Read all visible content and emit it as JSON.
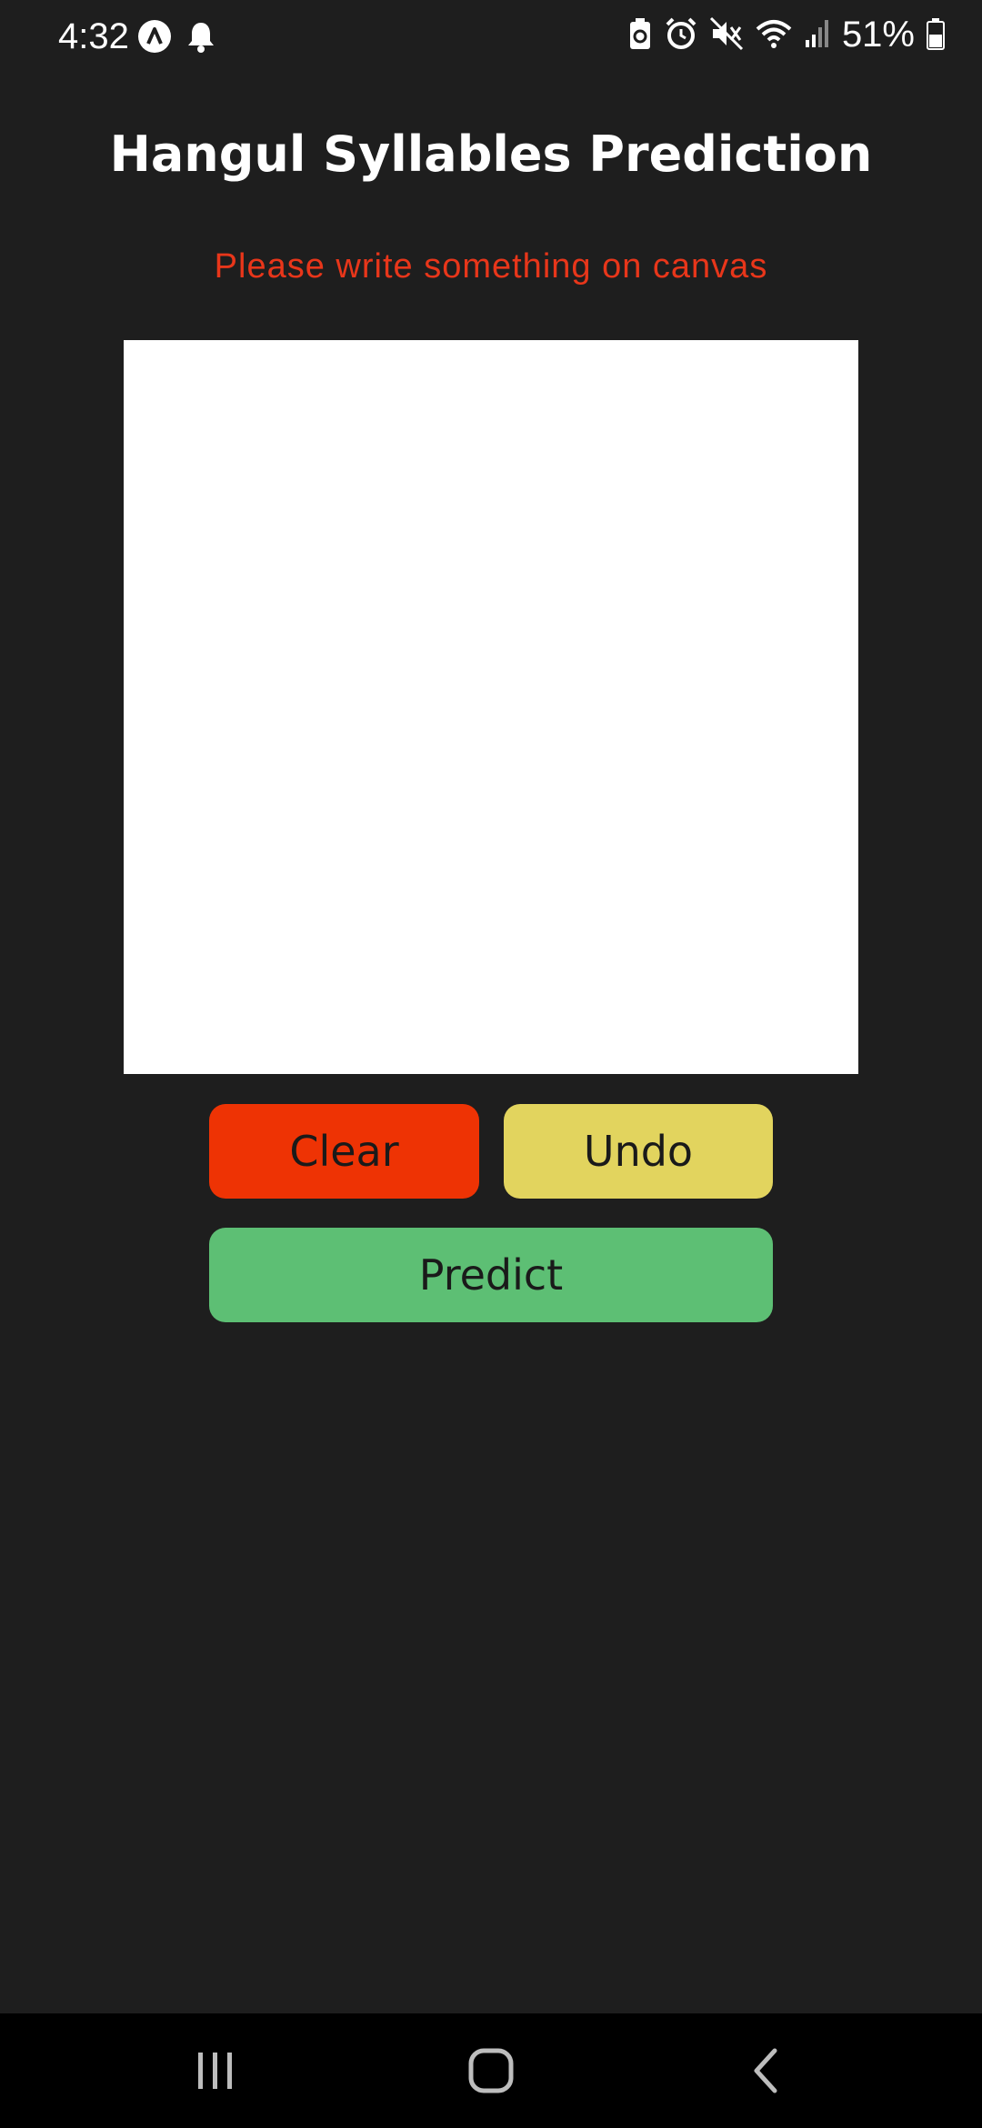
{
  "status_bar": {
    "time": "4:32",
    "battery": "51%"
  },
  "title": "Hangul Syllables Prediction",
  "hint": {
    "text": "Please write something on canvas",
    "color": "#e8361a"
  },
  "buttons": {
    "clear": {
      "label": "Clear",
      "color": "#ee3304"
    },
    "undo": {
      "label": "Undo",
      "color": "#e2d45e"
    },
    "predict": {
      "label": "Predict",
      "color": "#5dbf74"
    }
  },
  "icons": {
    "status_left": [
      "app-icon",
      "notification-bell-icon"
    ],
    "status_right": [
      "battery-saver-icon",
      "alarm-icon",
      "mute-icon",
      "wifi-icon",
      "signal-icon",
      "battery-icon"
    ],
    "nav": [
      "recent-apps-icon",
      "home-icon",
      "back-icon"
    ]
  }
}
